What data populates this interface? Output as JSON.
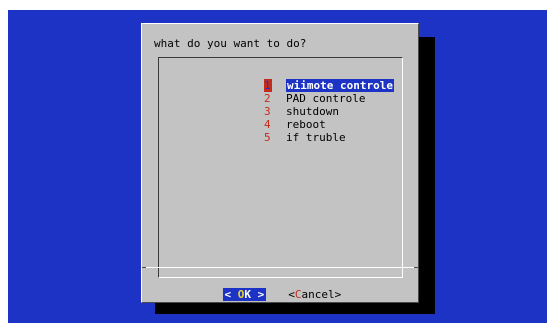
{
  "dialog": {
    "prompt": "what do you want to do?",
    "items": [
      {
        "tag": "1",
        "label": "wiimote controle",
        "selected": true
      },
      {
        "tag": "2",
        "label": "PAD controle"
      },
      {
        "tag": "3",
        "label": "shutdown"
      },
      {
        "tag": "4",
        "label": "reboot"
      },
      {
        "tag": "5",
        "label": "if truble"
      }
    ],
    "ok": {
      "left": "< ",
      "hot": "O",
      "rest": "K",
      "right": " >"
    },
    "cancel": {
      "left": "<",
      "hot": "C",
      "rest": "ancel",
      "right": ">"
    }
  },
  "colors": {
    "background": "#1d33c6",
    "dialog": "#c3c3c3",
    "accent": "#c42b1c",
    "selection": "#1d33c6"
  }
}
